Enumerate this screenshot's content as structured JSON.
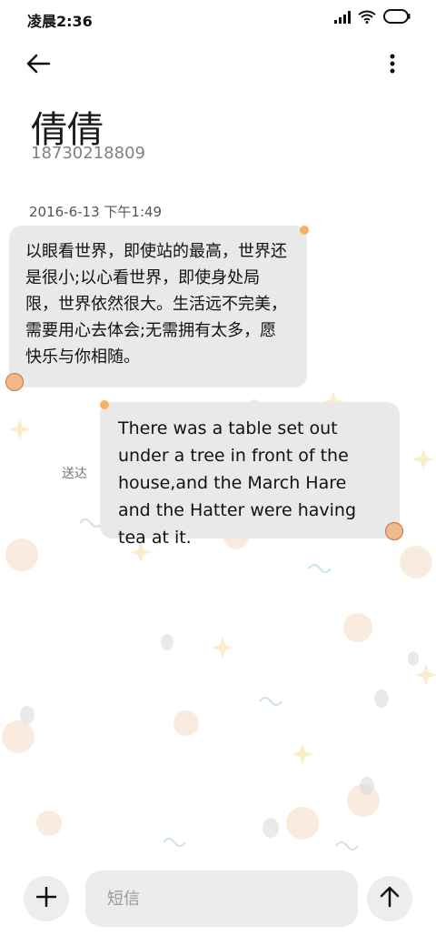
{
  "status_bar": {
    "time": "凌晨2:36"
  },
  "header": {
    "contact_name": "倩倩",
    "phone_number": "18730218809"
  },
  "conversation": {
    "timestamp": "2016-6-13 下午1:49",
    "incoming_message": "以眼看世界，即使站的最高，世界还是很小;以心看世界，即使身处局限，世界依然很大。生活远不完美，需要用心去体会;无需拥有太多，愿快乐与你相随。",
    "outgoing_message": "There was a table set out under a tree in front of the house,and the March Hare and the Hatter were having tea at it.",
    "sent_label": "送达"
  },
  "composer": {
    "placeholder": "短信"
  },
  "icons": {
    "back": "arrow-left-icon",
    "more": "more-vertical-icon",
    "add": "plus-icon",
    "send": "arrow-up-icon",
    "signal": "signal-icon",
    "wifi": "wifi-icon",
    "battery": "battery-icon"
  },
  "colors": {
    "bubble": "#e9e9e9",
    "background": "#ffffff",
    "secondary_text": "#808080"
  }
}
